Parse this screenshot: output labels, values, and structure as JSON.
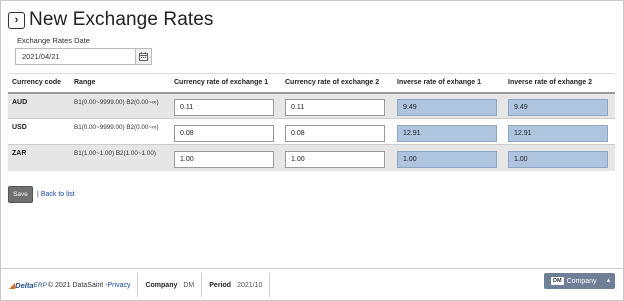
{
  "page": {
    "title": "New Exchange Rates",
    "toggle_icon": "chevron-right-icon",
    "toggle_glyph": "›"
  },
  "date": {
    "label": "Exchange Rates Date",
    "value": "2021/04/21",
    "icon": "calendar-icon"
  },
  "table": {
    "headers": {
      "currency_code": "Currency code",
      "range": "Range",
      "rate1": "Currency rate of exchange 1",
      "rate2": "Currency rate of exchange 2",
      "inverse1": "Inverse rate of exhange 1",
      "inverse2": "Inverse rate of exhange 2"
    },
    "rows": [
      {
        "code": "AUD",
        "range": "B1(0.00~9999.00) B2(0.00~∞)",
        "rate1": "0.11",
        "rate2": "0.11",
        "inverse1": "9.49",
        "inverse2": "9.49"
      },
      {
        "code": "USD",
        "range": "B1(0.00~9999.00) B2(0.00~∞)",
        "rate1": "0.08",
        "rate2": "0.08",
        "inverse1": "12.91",
        "inverse2": "12.91"
      },
      {
        "code": "ZAR",
        "range": "B1(1.00~1.00) B2(1.00~1.00)",
        "rate1": "1.00",
        "rate2": "1.00",
        "inverse1": "1.00",
        "inverse2": "1.00"
      }
    ]
  },
  "actions": {
    "save_label": "Save",
    "separator": "|",
    "back_label": "Back to list"
  },
  "footer": {
    "brand_mark": "◢",
    "brand_delta": "Delta",
    "brand_erp": "ERP",
    "copyright": "© 2021 DataSaint - ",
    "privacy": "Privacy",
    "company_label": "Company",
    "company_value": "DM",
    "period_label": "Period",
    "period_value": "2021/10",
    "company_button_badge": "DM",
    "company_button_label": "Company",
    "company_button_caret": "▲"
  },
  "colors": {
    "readonly_field": "#aec4df",
    "company_button": "#6f7f96",
    "link": "#1a4aa8",
    "brand_orange": "#e06a1f"
  }
}
